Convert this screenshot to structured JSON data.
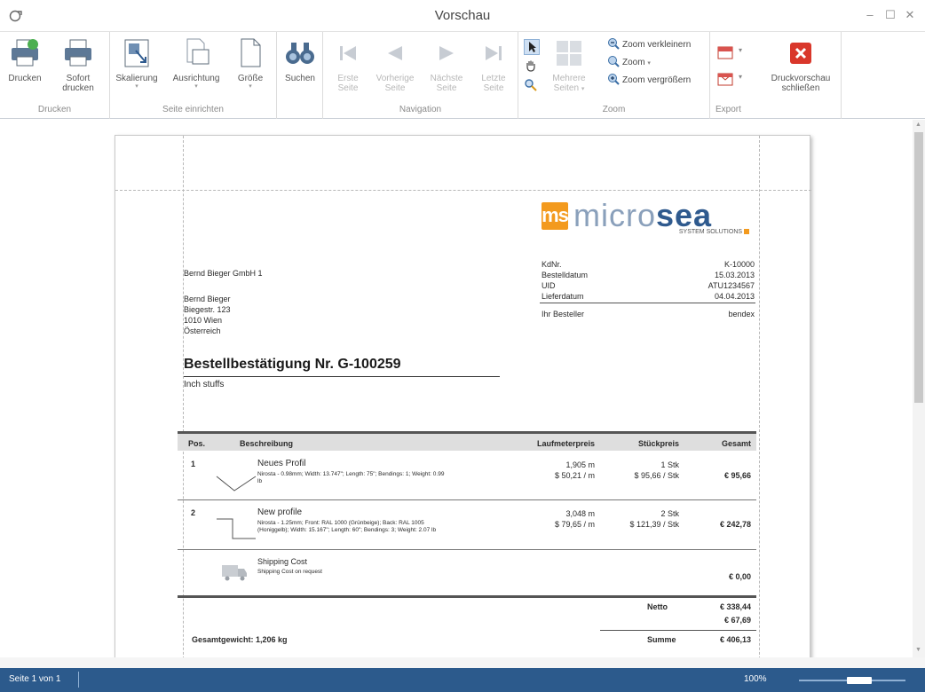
{
  "window": {
    "title": "Vorschau"
  },
  "ribbon": {
    "print": {
      "caption": "Drucken",
      "print_label": "Drucken",
      "quick_print_line1": "Sofort",
      "quick_print_line2": "drucken"
    },
    "page_setup": {
      "caption": "Seite einrichten",
      "scaling_label": "Skalierung",
      "orientation_label": "Ausrichtung",
      "size_label": "Größe"
    },
    "find_label": "Suchen",
    "navigation": {
      "caption": "Navigation",
      "first_line1": "Erste",
      "first_line2": "Seite",
      "prev_line1": "Vorherige",
      "prev_line2": "Seite",
      "next_line1": "Nächste",
      "next_line2": "Seite",
      "last_line1": "Letzte",
      "last_line2": "Seite"
    },
    "zoom": {
      "caption": "Zoom",
      "multi_line1": "Mehrere",
      "multi_line2": "Seiten",
      "zoom_out": "Zoom verkleinern",
      "zoom": "Zoom",
      "zoom_in": "Zoom vergrößern"
    },
    "export": {
      "caption": "Export"
    },
    "close_preview": {
      "line1": "Druckvorschau",
      "line2": "schließen"
    }
  },
  "document": {
    "logo": {
      "ms": "ms",
      "text_micro": "micro",
      "text_sea": "sea",
      "tagline": "SYSTEM SOLUTIONS"
    },
    "company": "Bernd Bieger GmbH 1",
    "address": [
      "Bernd Bieger",
      "Biegestr. 123",
      "1010 Wien",
      "Österreich"
    ],
    "meta": [
      {
        "label": "KdNr.",
        "value": "K-10000"
      },
      {
        "label": "Bestelldatum",
        "value": "15.03.2013"
      },
      {
        "label": "UID",
        "value": "ATU1234567"
      },
      {
        "label": "Lieferdatum",
        "value": "04.04.2013"
      }
    ],
    "orderer": {
      "label": "Ihr Besteller",
      "value": "bendex"
    },
    "heading": "Bestellbestätigung Nr. G-100259",
    "subheading": "Inch stuffs",
    "table": {
      "headers": [
        "Pos.",
        "Beschreibung",
        "Laufmeterpreis",
        "Stückpreis",
        "Gesamt"
      ],
      "rows": [
        {
          "pos": "1",
          "name": "Neues Profil",
          "desc1": "Nirosta - 0.98mm; Width: 13.747\"; Length: 75\"; Bendings: 1; Weight: 0.99",
          "desc2": "lb",
          "qty_m": "1,905 m",
          "price_m": "$ 50,21 / m",
          "qty_pcs": "1 Stk",
          "price_pcs": "$ 95,66 / Stk",
          "total": "€ 95,66"
        },
        {
          "pos": "2",
          "name": "New profile",
          "desc1": "Nirosta - 1.25mm; Front: RAL 1000 (Grünbeige); Back: RAL 1005",
          "desc2": "(Honiggelb); Width: 15.167\"; Length: 60\"; Bendings: 3; Weight: 2.07 lb",
          "qty_m": "3,048 m",
          "price_m": "$ 79,65 / m",
          "qty_pcs": "2 Stk",
          "price_pcs": "$ 121,39 / Stk",
          "total": "€ 242,78"
        },
        {
          "pos": "",
          "name": "Shipping Cost",
          "desc1": "Shipping Cost on request",
          "desc2": "",
          "qty_m": "",
          "price_m": "",
          "qty_pcs": "",
          "price_pcs": "",
          "total": "€ 0,00"
        }
      ]
    },
    "netto_label": "Netto",
    "netto_value": "€ 338,44",
    "tax_value": "€ 67,69",
    "weight_label": "Gesamtgewicht: 1,206 kg",
    "sum_label": "Summe",
    "sum_value": "€ 406,13"
  },
  "status": {
    "page": "Seite 1 von 1",
    "zoom": "100%"
  },
  "colors": {
    "accent_orange": "#f39a1e",
    "logo_blue": "#2f5a8e",
    "status_blue": "#2c5a8c"
  }
}
